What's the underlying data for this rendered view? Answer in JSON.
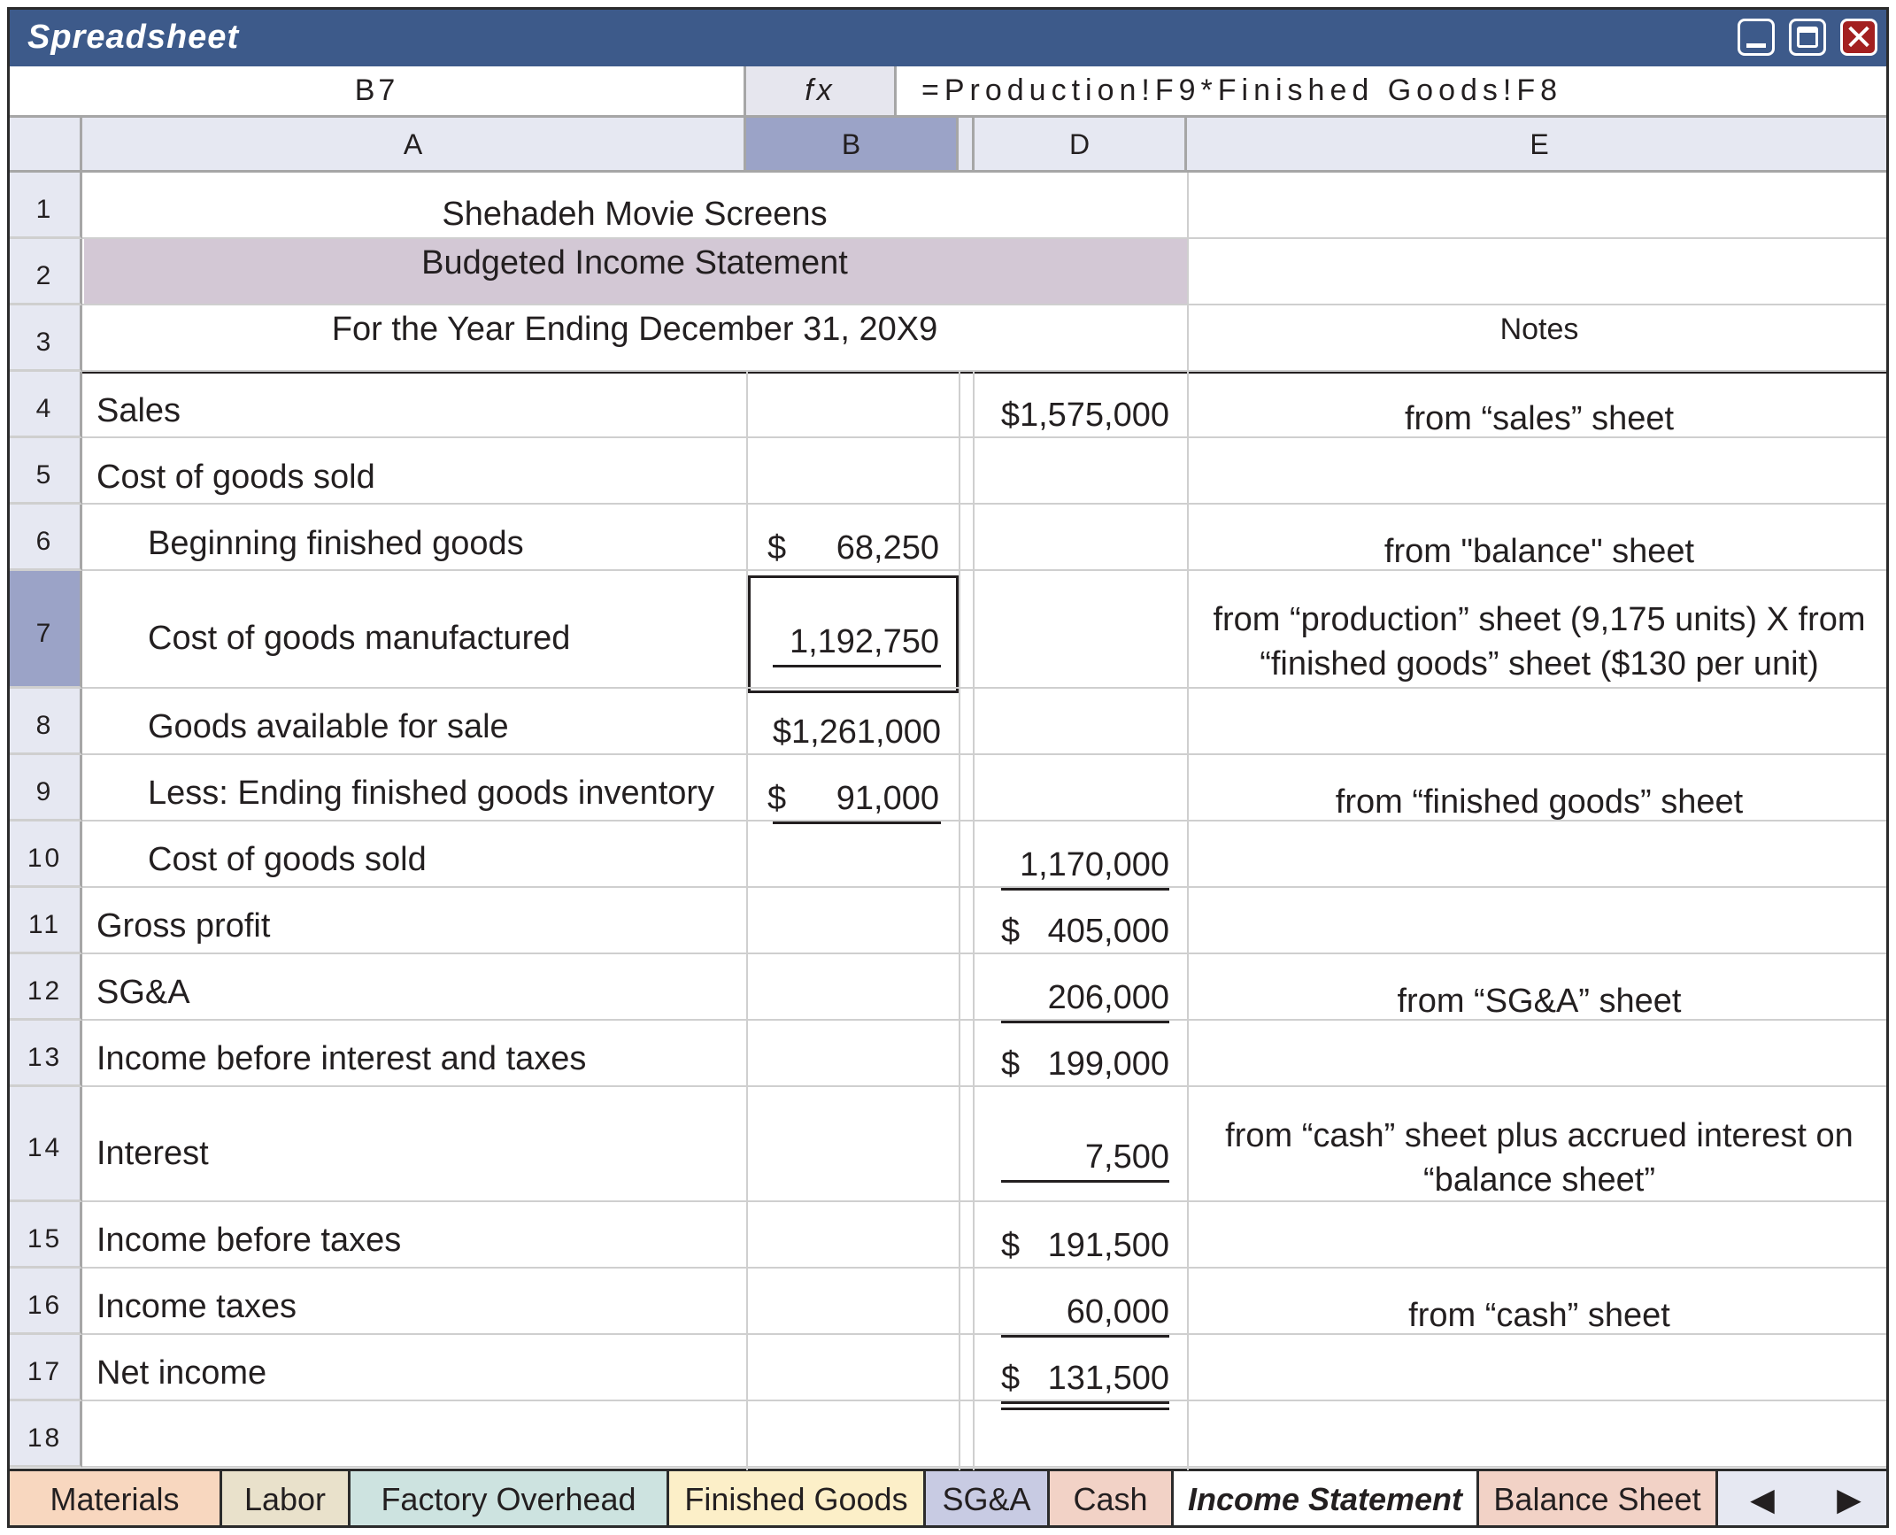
{
  "window": {
    "title": "Spreadsheet"
  },
  "formula_bar": {
    "cell_ref": "B7",
    "fx_label": "fx",
    "formula": "=Production!F9*Finished Goods!F8"
  },
  "columns": [
    "A",
    "B",
    "D",
    "E"
  ],
  "row_numbers": [
    "1",
    "2",
    "3",
    "4",
    "5",
    "6",
    "7",
    "8",
    "9",
    "10",
    "11",
    "12",
    "13",
    "14",
    "15",
    "16",
    "17",
    "18"
  ],
  "header": {
    "company": "Shehadeh Movie Screens",
    "statement": "Budgeted Income Statement",
    "period": "For the Year Ending December 31, 20X9",
    "notes_label": "Notes"
  },
  "rows": {
    "r4": {
      "label": "Sales",
      "d": "$1,575,000",
      "note": "from “sales” sheet"
    },
    "r5": {
      "label": "Cost of goods sold"
    },
    "r6": {
      "label": "Beginning finished goods",
      "b_sym": "$",
      "b": "68,250",
      "note": "from \"balance\" sheet"
    },
    "r7": {
      "label": "Cost of goods manufactured",
      "b": "1,192,750",
      "note_1": "from “production” sheet (9,175 units) X from",
      "note_2": "“finished goods” sheet ($130 per unit)"
    },
    "r8": {
      "label": "Goods available for sale",
      "b": "$1,261,000"
    },
    "r9": {
      "label": "Less: Ending finished goods inventory",
      "b_sym": "$",
      "b": "91,000",
      "note": "from “finished goods” sheet"
    },
    "r10": {
      "label": "Cost of goods sold",
      "d": "1,170,000"
    },
    "r11": {
      "label": "Gross profit",
      "d_sym": "$",
      "d": "405,000"
    },
    "r12": {
      "label": "SG&A",
      "d": "206,000",
      "note": "from “SG&A” sheet"
    },
    "r13": {
      "label": "Income before interest and taxes",
      "d_sym": "$",
      "d": "199,000"
    },
    "r14": {
      "label": "Interest",
      "d": "7,500",
      "note_1": "from “cash” sheet plus accrued interest on",
      "note_2": "“balance sheet”"
    },
    "r15": {
      "label": "Income before taxes",
      "d_sym": "$",
      "d": "191,500"
    },
    "r16": {
      "label": "Income taxes",
      "d": "60,000",
      "note": "from “cash” sheet"
    },
    "r17": {
      "label": "Net income",
      "d_sym": "$",
      "d": "131,500"
    }
  },
  "tabs": [
    "Materials",
    "Labor",
    "Factory Overhead",
    "Finished Goods",
    "SG&A",
    "Cash",
    "Income Statement",
    "Balance Sheet"
  ],
  "tab_colors": [
    "#f8d7bf",
    "#e9e1cb",
    "#cde3e0",
    "#fcefc8",
    "#c8cbe3",
    "#f2d2c6",
    "#ffffff",
    "#f2d2c6"
  ],
  "colors": {
    "title_bar": "#3d5a8a",
    "header_fill": "#d3c8d5",
    "selected_header": "#9ba3c7",
    "close_button": "#a32020"
  }
}
